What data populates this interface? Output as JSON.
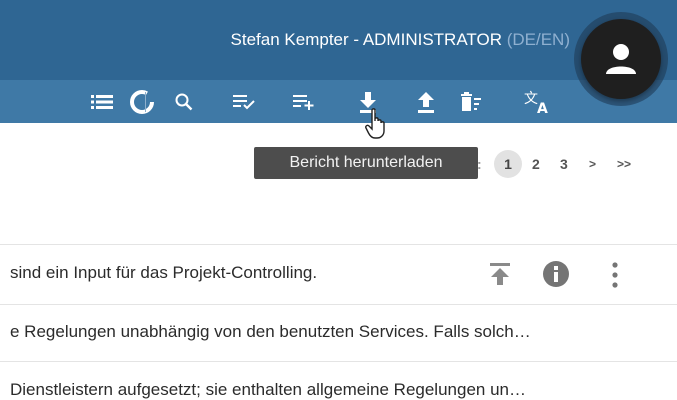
{
  "header": {
    "user_name": "Stefan Kempter - ADMINISTRATOR",
    "language": "(DE/EN)",
    "avatar_icon": "person-icon"
  },
  "toolbar": {
    "icons": [
      "list-icon",
      "refresh-icon",
      "search-icon",
      "playlist-check-icon",
      "playlist-add-icon",
      "download-icon",
      "upload-icon",
      "delete-sweep-icon",
      "translate-icon"
    ]
  },
  "tooltip": {
    "text": "Bericht herunterladen"
  },
  "pagination": {
    "pages": [
      "1",
      "2",
      "3"
    ],
    "current": "1",
    "next": ">",
    "last": ">>"
  },
  "rows": [
    {
      "text": "sind ein Input für das Projekt-Controlling."
    },
    {
      "text": "e Regelungen unabhängig von den benutzten Services. Falls solch…"
    },
    {
      "text": "Dienstleistern aufgesetzt; sie enthalten allgemeine Regelungen un…"
    }
  ],
  "colors": {
    "header": "#2f6693",
    "toolbar": "#3f79a6",
    "icon": "#ffffff",
    "row_icon": "#8a8a8a"
  }
}
